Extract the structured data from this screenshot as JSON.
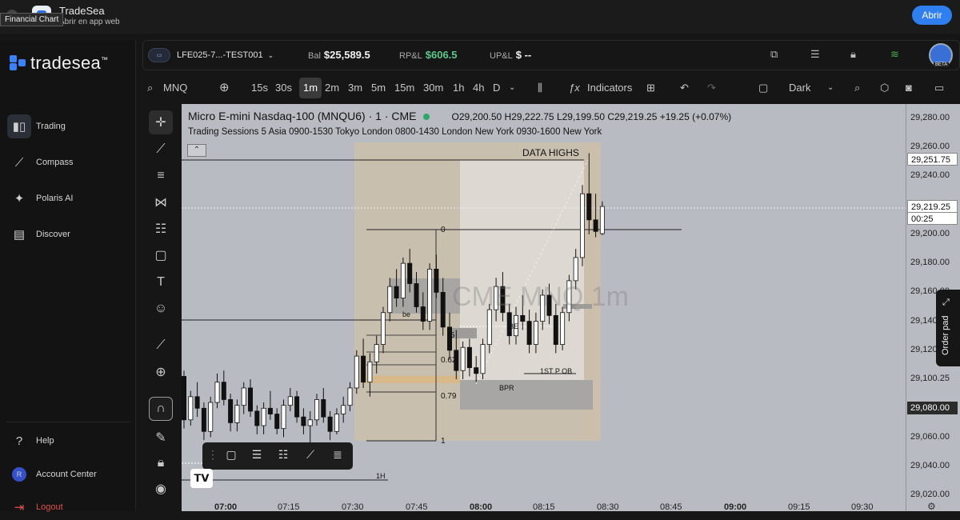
{
  "banner": {
    "title": "TradeSea",
    "subtitle": "Abrir en app web",
    "tooltip": "Financial Chart",
    "open_label": "Abrir"
  },
  "sidebar": {
    "brand": "tradesea",
    "brand_tm": "™",
    "items": [
      {
        "label": "Trading",
        "icon": "trading-icon"
      },
      {
        "label": "Compass",
        "icon": "compass-icon"
      },
      {
        "label": "Polaris AI",
        "icon": "polaris-icon"
      },
      {
        "label": "Discover",
        "icon": "discover-icon"
      }
    ],
    "bottom": [
      {
        "label": "Help",
        "icon": "help-icon"
      },
      {
        "label": "Account Center",
        "avatar": "R"
      },
      {
        "label": "Logout",
        "icon": "logout-icon"
      }
    ]
  },
  "account": {
    "id": "LFE025-7...-TEST001",
    "balance_label": "Bal",
    "balance": "$25,589.5",
    "rpl_label": "RP&L",
    "rpl": "$606.5",
    "upl_label": "UP&L",
    "upl": "$ --",
    "beta": "BETA",
    "accent_green": "#5cc98a"
  },
  "toolbar": {
    "symbol": "MNQ",
    "intervals": [
      "15s",
      "30s",
      "1m",
      "2m",
      "3m",
      "5m",
      "15m",
      "30m",
      "1h",
      "4h",
      "D"
    ],
    "selected_interval": "1m",
    "indicators": "Indicators",
    "theme": "Dark"
  },
  "chart": {
    "title": "Micro E-mini Nasdaq-100 (MNQU6) · 1 · CME",
    "ohlc": "O29,200.50 H29,222.75 L29,199.50 C29,219.25 +19.25 (+0.07%)",
    "sessions": "Trading Sessions 5 Asia 0900-1530 Tokyo London 0800-1430 London New York 0930-1600 New York",
    "watermark": "CME MNQ 1m",
    "labels": {
      "data_highs": "DATA HIGHS",
      "fib_0": "0",
      "fib_5": ".5",
      "fib_62": "0.62",
      "fib_79": "0.79",
      "fib_1": "1",
      "be1": "be",
      "be2": "BE",
      "ob": "1ST P OB",
      "bpr": "BPR",
      "h1": "1H"
    },
    "order_pad": "Order pad"
  },
  "chart_data": {
    "type": "candlestick",
    "title": "Micro E-mini Nasdaq-100 (MNQU6) · 1 · CME",
    "ylim": [
      29010,
      29290
    ],
    "y_ticks": [
      29280,
      29260,
      29240,
      29200,
      29180,
      29160,
      29140,
      29120,
      29100.25,
      29080,
      29060,
      29040,
      29020
    ],
    "y_tick_labels": [
      "29,280.00",
      "29,260.00",
      "29,240.00",
      "29,200.00",
      "29,180.00",
      "29,160.00",
      "29,140.00",
      "29,120.00",
      "29,100.25",
      "29,080.00",
      "29,060.00",
      "29,040.00",
      "29,020.00"
    ],
    "price_tags": [
      {
        "label": "29,251.75",
        "value": 29251.75
      },
      {
        "label": "29,219.25",
        "value": 29219.25,
        "sub": "00:25"
      },
      {
        "label": "29,080.00",
        "value": 29080.0
      }
    ],
    "x_ticks": [
      "07:00",
      "07:15",
      "07:30",
      "07:45",
      "08:00",
      "08:15",
      "08:30",
      "08:45",
      "09:00",
      "09:15",
      "09:30"
    ],
    "bold_x_ticks": [
      "07:00",
      "08:00",
      "09:00"
    ],
    "candles": [
      [
        29102,
        29106,
        29066,
        29072
      ],
      [
        29072,
        29092,
        29068,
        29088
      ],
      [
        29088,
        29098,
        29074,
        29080
      ],
      [
        29080,
        29084,
        29058,
        29064
      ],
      [
        29064,
        29088,
        29060,
        29084
      ],
      [
        29084,
        29104,
        29080,
        29098
      ],
      [
        29098,
        29106,
        29082,
        29086
      ],
      [
        29086,
        29090,
        29064,
        29070
      ],
      [
        29070,
        29086,
        29064,
        29082
      ],
      [
        29082,
        29098,
        29076,
        29094
      ],
      [
        29094,
        29100,
        29074,
        29078
      ],
      [
        29078,
        29082,
        29062,
        29068
      ],
      [
        29068,
        29084,
        29062,
        29080
      ],
      [
        29080,
        29092,
        29072,
        29076
      ],
      [
        29076,
        29080,
        29062,
        29066
      ],
      [
        29066,
        29086,
        29060,
        29082
      ],
      [
        29082,
        29094,
        29078,
        29088
      ],
      [
        29088,
        29092,
        29070,
        29074
      ],
      [
        29074,
        29080,
        29062,
        29068
      ],
      [
        29068,
        29078,
        29056,
        29072
      ],
      [
        29072,
        29090,
        29068,
        29086
      ],
      [
        29086,
        29094,
        29070,
        29074
      ],
      [
        29074,
        29078,
        29058,
        29064
      ],
      [
        29064,
        29080,
        29062,
        29076
      ],
      [
        29076,
        29088,
        29070,
        29082
      ],
      [
        29082,
        29098,
        29078,
        29094
      ],
      [
        29094,
        29120,
        29090,
        29116
      ],
      [
        29116,
        29128,
        29094,
        29098
      ],
      [
        29098,
        29118,
        29088,
        29112
      ],
      [
        29112,
        29130,
        29104,
        29124
      ],
      [
        29124,
        29150,
        29118,
        29146
      ],
      [
        29146,
        29170,
        29140,
        29164
      ],
      [
        29164,
        29176,
        29150,
        29156
      ],
      [
        29156,
        29184,
        29150,
        29180
      ],
      [
        29180,
        29190,
        29160,
        29166
      ],
      [
        29166,
        29174,
        29146,
        29150
      ],
      [
        29150,
        29160,
        29134,
        29140
      ],
      [
        29140,
        29180,
        29134,
        29176
      ],
      [
        29176,
        29186,
        29156,
        29160
      ],
      [
        29160,
        29170,
        29130,
        29136
      ],
      [
        29136,
        29146,
        29114,
        29120
      ],
      [
        29120,
        29134,
        29100,
        29106
      ],
      [
        29106,
        29126,
        29100,
        29122
      ],
      [
        29122,
        29128,
        29102,
        29108
      ],
      [
        29108,
        29116,
        29098,
        29104
      ],
      [
        29104,
        29128,
        29100,
        29124
      ],
      [
        29124,
        29152,
        29118,
        29148
      ],
      [
        29148,
        29170,
        29140,
        29164
      ],
      [
        29164,
        29174,
        29140,
        29146
      ],
      [
        29146,
        29152,
        29124,
        29130
      ],
      [
        29130,
        29150,
        29124,
        29144
      ],
      [
        29144,
        29158,
        29134,
        29140
      ],
      [
        29140,
        29148,
        29118,
        29124
      ],
      [
        29124,
        29146,
        29118,
        29140
      ],
      [
        29140,
        29162,
        29134,
        29158
      ],
      [
        29158,
        29166,
        29138,
        29144
      ],
      [
        29144,
        29152,
        29118,
        29124
      ],
      [
        29124,
        29150,
        29120,
        29146
      ],
      [
        29146,
        29172,
        29140,
        29168
      ],
      [
        29168,
        29190,
        29162,
        29184
      ],
      [
        29184,
        29234,
        29178,
        29228
      ],
      [
        29228,
        29256,
        29200,
        29210
      ],
      [
        29210,
        29228,
        29198,
        29202
      ],
      [
        29200.5,
        29222.75,
        29199.5,
        29219.25
      ]
    ]
  }
}
